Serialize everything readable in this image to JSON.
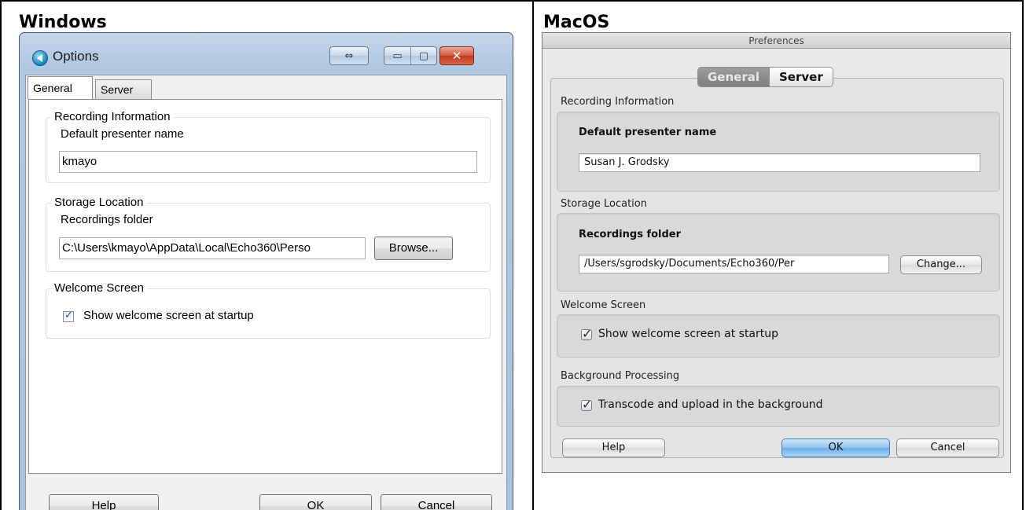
{
  "labels": {
    "windows": "Windows",
    "macos": "MacOS"
  },
  "windows": {
    "title": "Options",
    "caption_buttons": {
      "resize": "⇔",
      "minimize": "▭",
      "maximize": "▢",
      "close": "✕"
    },
    "tabs": [
      {
        "label": "General"
      },
      {
        "label": "Server"
      }
    ],
    "recording_information": {
      "heading": "Recording Information",
      "field_label": "Default presenter name",
      "value": "kmayo"
    },
    "storage_location": {
      "heading": "Storage Location",
      "field_label": "Recordings folder",
      "value": "C:\\Users\\kmayo\\AppData\\Local\\Echo360\\Perso",
      "button": "Browse..."
    },
    "welcome_screen": {
      "heading": "Welcome Screen",
      "checkbox_label": "Show welcome screen at startup",
      "checked": true
    },
    "buttons": {
      "help": "Help",
      "ok": "OK",
      "cancel": "Cancel"
    }
  },
  "macos": {
    "title": "Preferences",
    "tabs": [
      {
        "label": "General"
      },
      {
        "label": "Server"
      }
    ],
    "recording_information": {
      "heading": "Recording Information",
      "field_label": "Default presenter name",
      "value": "Susan J. Grodsky"
    },
    "storage_location": {
      "heading": "Storage Location",
      "field_label": "Recordings folder",
      "value": "/Users/sgrodsky/Documents/Echo360/Per",
      "button": "Change..."
    },
    "welcome_screen": {
      "heading": "Welcome Screen",
      "checkbox_label": "Show welcome screen at startup",
      "checked": true
    },
    "background_processing": {
      "heading": "Background Processing",
      "checkbox_label": "Transcode and upload in the background",
      "checked": true
    },
    "buttons": {
      "help": "Help",
      "ok": "OK",
      "cancel": "Cancel"
    }
  }
}
